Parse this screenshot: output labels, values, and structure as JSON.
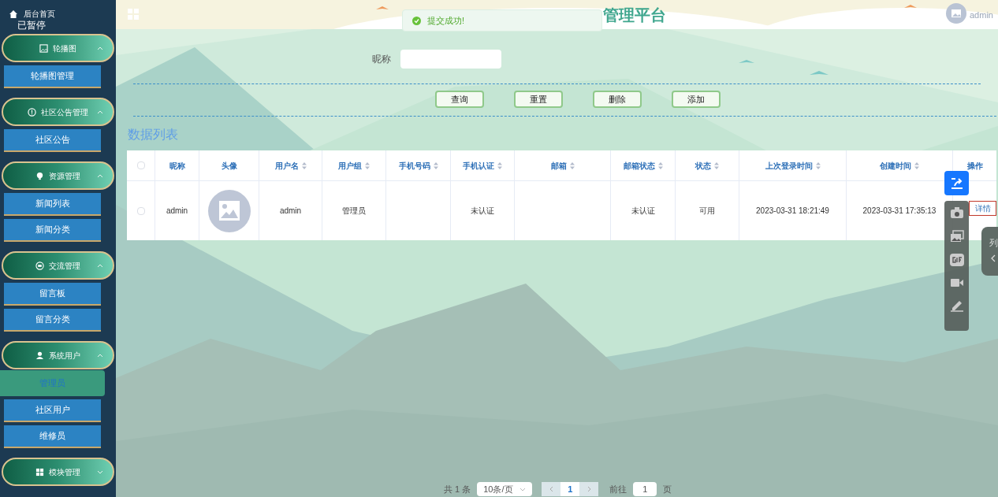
{
  "sidebar": {
    "home_link": "后台首页",
    "paused_label": "已暂停",
    "groups": [
      {
        "title": "轮播图",
        "expanded": true,
        "items": [
          {
            "label": "轮播图管理",
            "selected": false
          }
        ]
      },
      {
        "title": "社区公告管理",
        "expanded": true,
        "items": [
          {
            "label": "社区公告",
            "selected": false
          }
        ]
      },
      {
        "title": "资源管理",
        "expanded": true,
        "items": [
          {
            "label": "新闻列表",
            "selected": false
          },
          {
            "label": "新闻分类",
            "selected": false
          }
        ]
      },
      {
        "title": "交流管理",
        "expanded": true,
        "items": [
          {
            "label": "留言板",
            "selected": false
          },
          {
            "label": "留言分类",
            "selected": false
          }
        ]
      },
      {
        "title": "系统用户",
        "expanded": true,
        "items": [
          {
            "label": "管理员",
            "selected": true
          },
          {
            "label": "社区用户",
            "selected": false
          },
          {
            "label": "维修员",
            "selected": false
          }
        ]
      },
      {
        "title": "模块管理",
        "expanded": false
      }
    ]
  },
  "header": {
    "title": "管理平台",
    "username": "admin"
  },
  "toast": {
    "message": "提交成功!"
  },
  "search": {
    "label": "昵称"
  },
  "buttons": [
    "查询",
    "重置",
    "删除",
    "添加"
  ],
  "section_title": "数据列表",
  "table": {
    "all_checked": false,
    "columns": [
      {
        "label": "昵称",
        "sortable": false
      },
      {
        "label": "头像",
        "sortable": false
      },
      {
        "label": "用户名",
        "sortable": true
      },
      {
        "label": "用户组",
        "sortable": true
      },
      {
        "label": "手机号码",
        "sortable": true
      },
      {
        "label": "手机认证",
        "sortable": true
      },
      {
        "label": "邮箱",
        "sortable": true
      },
      {
        "label": "邮箱状态",
        "sortable": true
      },
      {
        "label": "状态",
        "sortable": true
      },
      {
        "label": "上次登录时间",
        "sortable": true
      },
      {
        "label": "创建时间",
        "sortable": true
      },
      {
        "label": "操作",
        "sortable": false
      }
    ],
    "rows": [
      {
        "checked": false,
        "nickname": "admin",
        "username": "admin",
        "group": "管理员",
        "phone_status": "未认证",
        "email_status": "未认证",
        "status": "可用",
        "last_login": "2023-03-31 18:21:49",
        "created": "2023-03-31 17:35:13",
        "action": "详情"
      }
    ]
  },
  "pagination": {
    "total": "共 1 条",
    "page_size": "10条/页",
    "pages": [
      {
        "label": "1",
        "selected": true
      }
    ],
    "goto_label": "前往",
    "goto_value": "1",
    "goto_suffix": "页"
  },
  "side_tab": {
    "label": "列"
  }
}
